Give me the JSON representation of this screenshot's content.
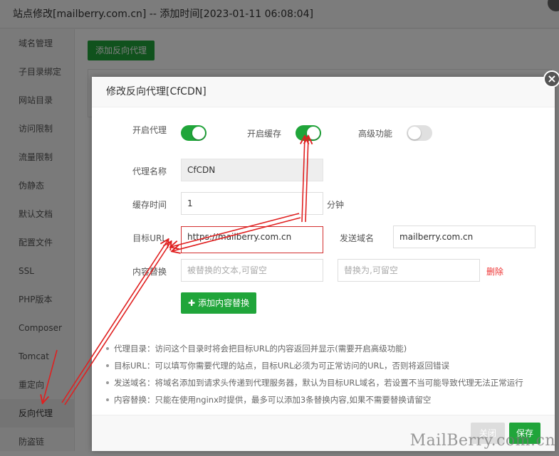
{
  "window": {
    "title": "站点修改[mailberry.com.cn] -- 添加时间[2023-01-11 06:08:04]"
  },
  "sidebar": {
    "items": [
      {
        "label": "域名管理"
      },
      {
        "label": "子目录绑定"
      },
      {
        "label": "网站目录"
      },
      {
        "label": "访问限制"
      },
      {
        "label": "流量限制"
      },
      {
        "label": "伪静态"
      },
      {
        "label": "默认文档"
      },
      {
        "label": "配置文件"
      },
      {
        "label": "SSL"
      },
      {
        "label": "PHP版本"
      },
      {
        "label": "Composer"
      },
      {
        "label": "Tomcat"
      },
      {
        "label": "重定向"
      },
      {
        "label": "反向代理"
      },
      {
        "label": "防盗链"
      }
    ],
    "active": "反向代理"
  },
  "main": {
    "add_button": "添加反向代理"
  },
  "modal": {
    "title": "修改反向代理[CfCDN]",
    "enable_proxy_label": "开启代理",
    "enable_proxy": true,
    "enable_cache_label": "开启缓存",
    "enable_cache": true,
    "advanced_label": "高级功能",
    "advanced": false,
    "proxy_name_label": "代理名称",
    "proxy_name": "CfCDN",
    "cache_time_label": "缓存时间",
    "cache_time": "1",
    "cache_unit": "分钟",
    "target_url_label": "目标URL",
    "target_url": "https://mailberry.com.cn",
    "send_domain_label": "发送域名",
    "send_domain": "mailberry.com.cn",
    "content_replace_label": "内容替换",
    "replace_from_placeholder": "被替换的文本,可留空",
    "replace_to_placeholder": "替换为,可留空",
    "delete_label": "删除",
    "add_replace_button": "添加内容替换",
    "help": [
      "代理目录：访问这个目录时将会把目标URL的内容返回并显示(需要开启高级功能)",
      "目标URL：可以填写你需要代理的站点，目标URL必须为可正常访问的URL，否则将返回错误",
      "发送域名：将域名添加到请求头传递到代理服务器，默认为目标URL域名，若设置不当可能导致代理无法正常运行",
      "内容替换：只能在使用nginx时提供，最多可以添加3条替换内容,如果不需要替换请留空"
    ],
    "close_button": "关闭",
    "save_button": "保存",
    "close_icon": "×"
  },
  "watermark": "MailBerry.com.cn",
  "colors": {
    "accent": "#20a53a",
    "annotation": "#e02020",
    "danger": "#e33"
  }
}
